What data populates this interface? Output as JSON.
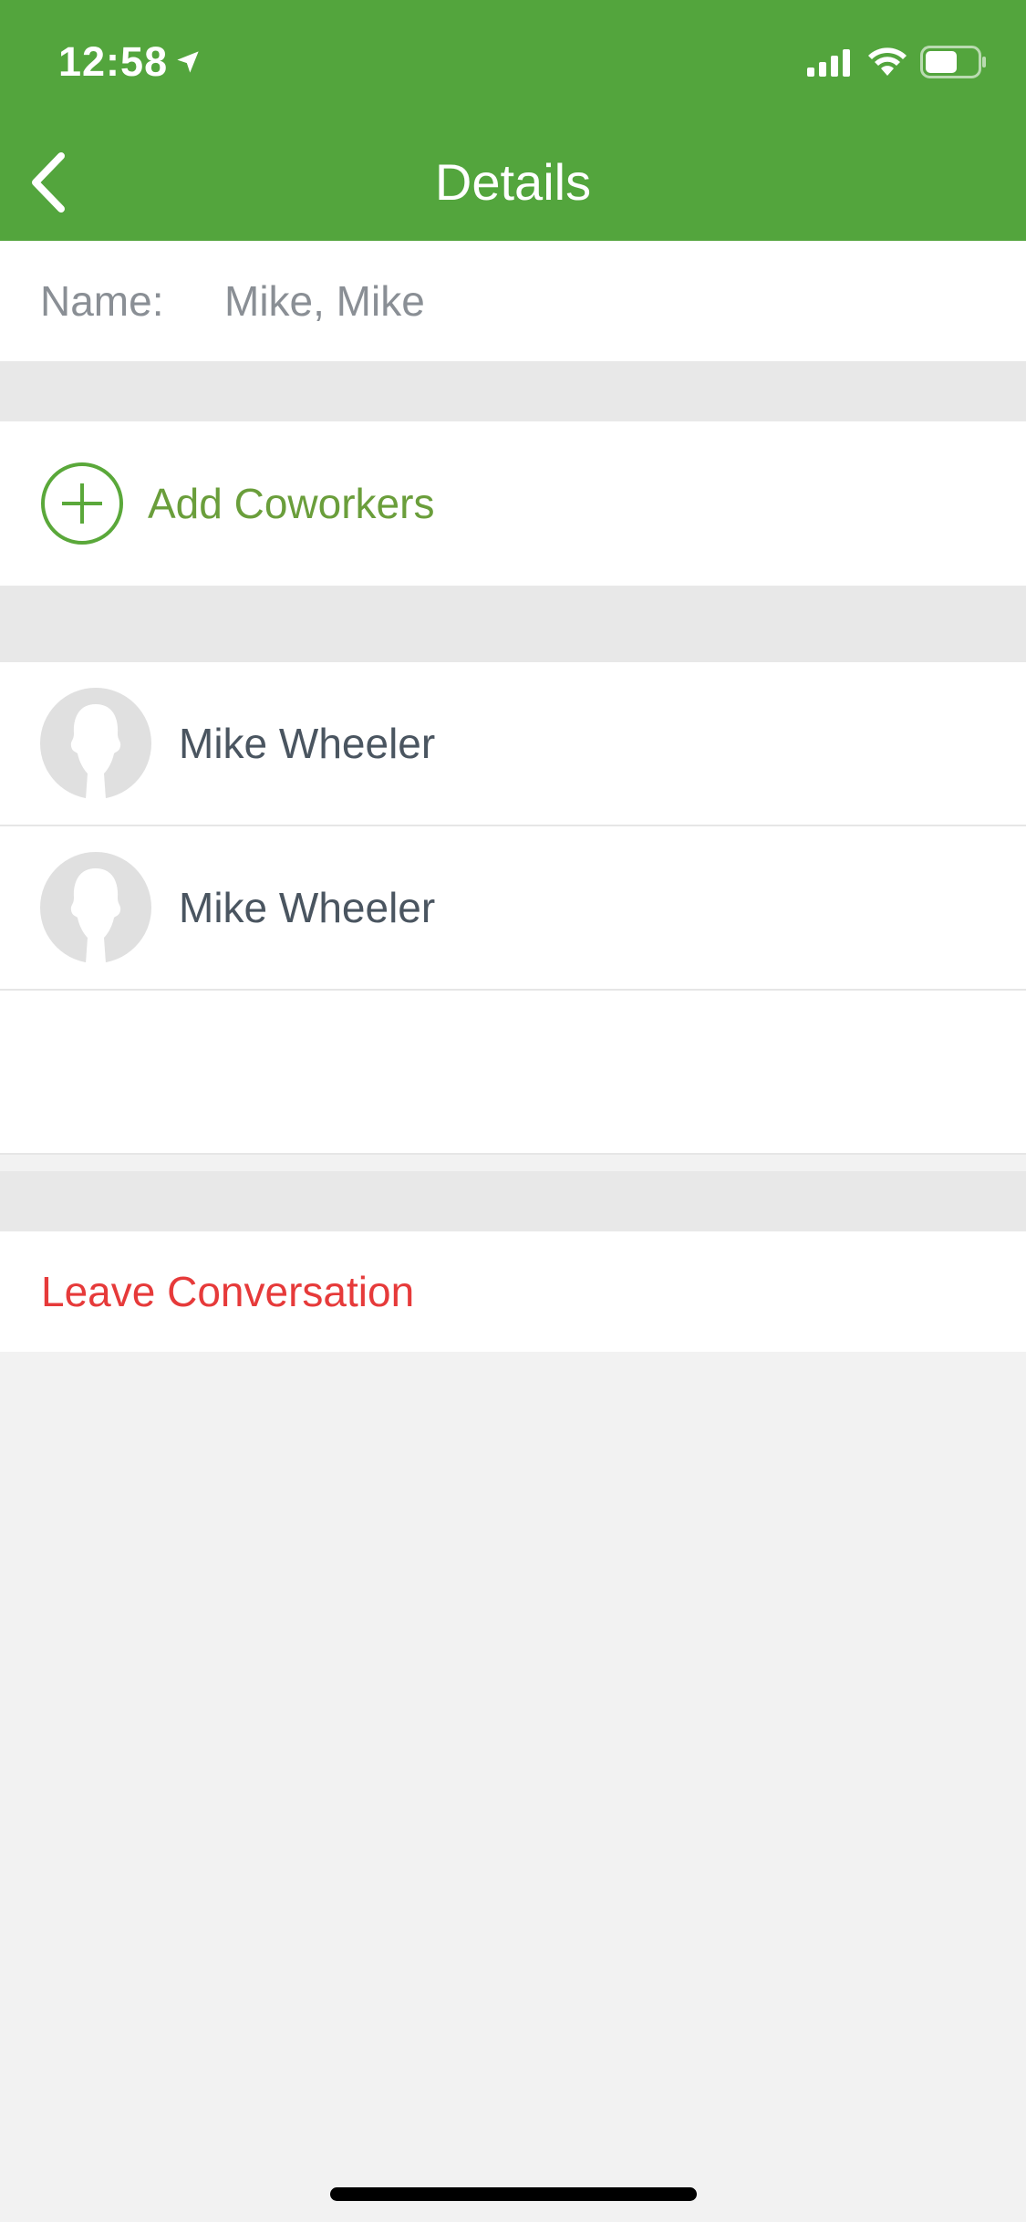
{
  "status_bar": {
    "time": "12:58",
    "icons": [
      "location-arrow-icon",
      "signal-icon",
      "wifi-icon",
      "battery-icon"
    ]
  },
  "nav": {
    "title": "Details",
    "back_icon": "chevron-left-icon"
  },
  "name_field": {
    "label": "Name:",
    "value": "Mike, Mike"
  },
  "add_coworkers": {
    "label": "Add Coworkers",
    "icon": "plus-circle-icon"
  },
  "members": [
    {
      "name": "Mike Wheeler",
      "avatar_icon": "person-silhouette-icon"
    },
    {
      "name": "Mike Wheeler",
      "avatar_icon": "person-silhouette-icon"
    }
  ],
  "leave": {
    "label": "Leave Conversation"
  },
  "colors": {
    "header": "#53a53d",
    "accent": "#6a9e3b",
    "danger": "#e63a3a",
    "background": "#f2f2f2"
  }
}
